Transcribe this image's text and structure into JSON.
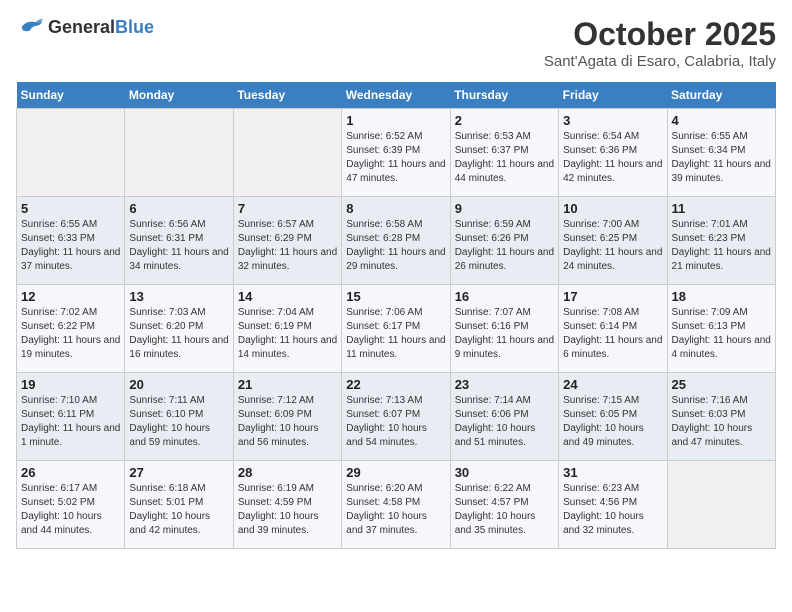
{
  "logo": {
    "general": "General",
    "blue": "Blue"
  },
  "header": {
    "month": "October 2025",
    "location": "Sant'Agata di Esaro, Calabria, Italy"
  },
  "weekdays": [
    "Sunday",
    "Monday",
    "Tuesday",
    "Wednesday",
    "Thursday",
    "Friday",
    "Saturday"
  ],
  "weeks": [
    [
      {
        "day": "",
        "info": ""
      },
      {
        "day": "",
        "info": ""
      },
      {
        "day": "",
        "info": ""
      },
      {
        "day": "1",
        "info": "Sunrise: 6:52 AM\nSunset: 6:39 PM\nDaylight: 11 hours and 47 minutes."
      },
      {
        "day": "2",
        "info": "Sunrise: 6:53 AM\nSunset: 6:37 PM\nDaylight: 11 hours and 44 minutes."
      },
      {
        "day": "3",
        "info": "Sunrise: 6:54 AM\nSunset: 6:36 PM\nDaylight: 11 hours and 42 minutes."
      },
      {
        "day": "4",
        "info": "Sunrise: 6:55 AM\nSunset: 6:34 PM\nDaylight: 11 hours and 39 minutes."
      }
    ],
    [
      {
        "day": "5",
        "info": "Sunrise: 6:55 AM\nSunset: 6:33 PM\nDaylight: 11 hours and 37 minutes."
      },
      {
        "day": "6",
        "info": "Sunrise: 6:56 AM\nSunset: 6:31 PM\nDaylight: 11 hours and 34 minutes."
      },
      {
        "day": "7",
        "info": "Sunrise: 6:57 AM\nSunset: 6:29 PM\nDaylight: 11 hours and 32 minutes."
      },
      {
        "day": "8",
        "info": "Sunrise: 6:58 AM\nSunset: 6:28 PM\nDaylight: 11 hours and 29 minutes."
      },
      {
        "day": "9",
        "info": "Sunrise: 6:59 AM\nSunset: 6:26 PM\nDaylight: 11 hours and 26 minutes."
      },
      {
        "day": "10",
        "info": "Sunrise: 7:00 AM\nSunset: 6:25 PM\nDaylight: 11 hours and 24 minutes."
      },
      {
        "day": "11",
        "info": "Sunrise: 7:01 AM\nSunset: 6:23 PM\nDaylight: 11 hours and 21 minutes."
      }
    ],
    [
      {
        "day": "12",
        "info": "Sunrise: 7:02 AM\nSunset: 6:22 PM\nDaylight: 11 hours and 19 minutes."
      },
      {
        "day": "13",
        "info": "Sunrise: 7:03 AM\nSunset: 6:20 PM\nDaylight: 11 hours and 16 minutes."
      },
      {
        "day": "14",
        "info": "Sunrise: 7:04 AM\nSunset: 6:19 PM\nDaylight: 11 hours and 14 minutes."
      },
      {
        "day": "15",
        "info": "Sunrise: 7:06 AM\nSunset: 6:17 PM\nDaylight: 11 hours and 11 minutes."
      },
      {
        "day": "16",
        "info": "Sunrise: 7:07 AM\nSunset: 6:16 PM\nDaylight: 11 hours and 9 minutes."
      },
      {
        "day": "17",
        "info": "Sunrise: 7:08 AM\nSunset: 6:14 PM\nDaylight: 11 hours and 6 minutes."
      },
      {
        "day": "18",
        "info": "Sunrise: 7:09 AM\nSunset: 6:13 PM\nDaylight: 11 hours and 4 minutes."
      }
    ],
    [
      {
        "day": "19",
        "info": "Sunrise: 7:10 AM\nSunset: 6:11 PM\nDaylight: 11 hours and 1 minute."
      },
      {
        "day": "20",
        "info": "Sunrise: 7:11 AM\nSunset: 6:10 PM\nDaylight: 10 hours and 59 minutes."
      },
      {
        "day": "21",
        "info": "Sunrise: 7:12 AM\nSunset: 6:09 PM\nDaylight: 10 hours and 56 minutes."
      },
      {
        "day": "22",
        "info": "Sunrise: 7:13 AM\nSunset: 6:07 PM\nDaylight: 10 hours and 54 minutes."
      },
      {
        "day": "23",
        "info": "Sunrise: 7:14 AM\nSunset: 6:06 PM\nDaylight: 10 hours and 51 minutes."
      },
      {
        "day": "24",
        "info": "Sunrise: 7:15 AM\nSunset: 6:05 PM\nDaylight: 10 hours and 49 minutes."
      },
      {
        "day": "25",
        "info": "Sunrise: 7:16 AM\nSunset: 6:03 PM\nDaylight: 10 hours and 47 minutes."
      }
    ],
    [
      {
        "day": "26",
        "info": "Sunrise: 6:17 AM\nSunset: 5:02 PM\nDaylight: 10 hours and 44 minutes."
      },
      {
        "day": "27",
        "info": "Sunrise: 6:18 AM\nSunset: 5:01 PM\nDaylight: 10 hours and 42 minutes."
      },
      {
        "day": "28",
        "info": "Sunrise: 6:19 AM\nSunset: 4:59 PM\nDaylight: 10 hours and 39 minutes."
      },
      {
        "day": "29",
        "info": "Sunrise: 6:20 AM\nSunset: 4:58 PM\nDaylight: 10 hours and 37 minutes."
      },
      {
        "day": "30",
        "info": "Sunrise: 6:22 AM\nSunset: 4:57 PM\nDaylight: 10 hours and 35 minutes."
      },
      {
        "day": "31",
        "info": "Sunrise: 6:23 AM\nSunset: 4:56 PM\nDaylight: 10 hours and 32 minutes."
      },
      {
        "day": "",
        "info": ""
      }
    ]
  ]
}
